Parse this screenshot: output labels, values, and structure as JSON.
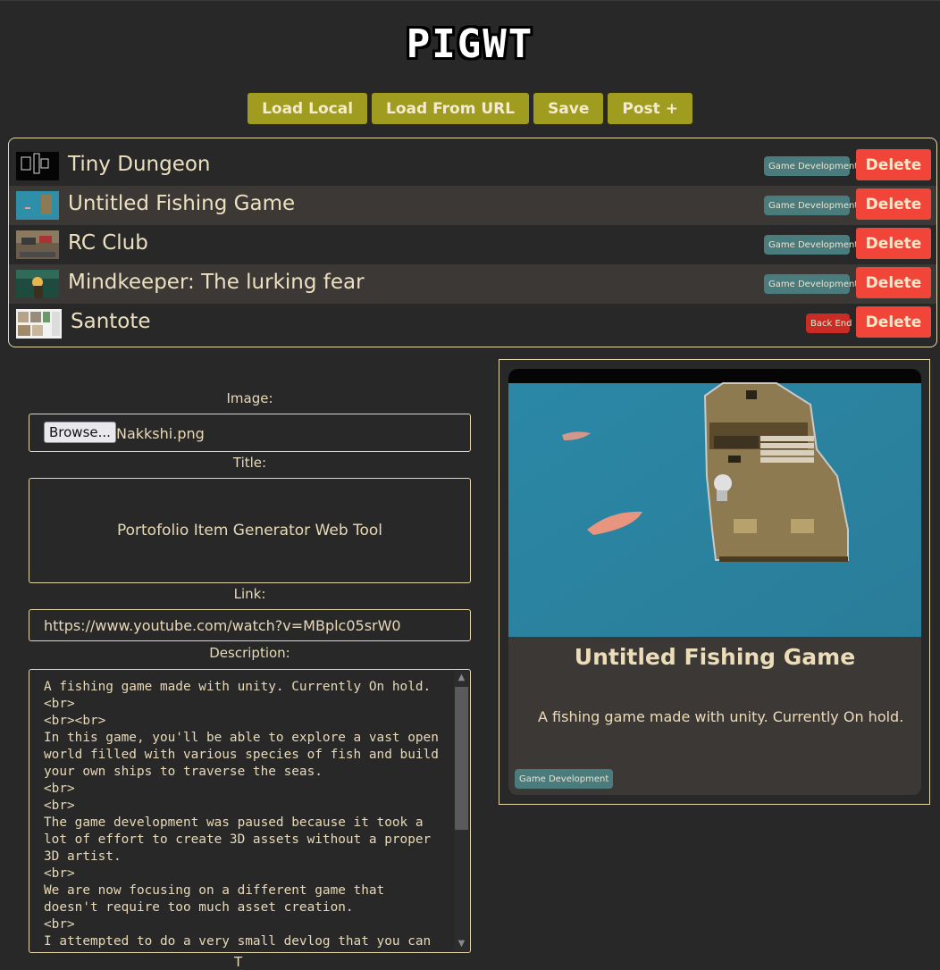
{
  "app": {
    "logo": "PIGWT"
  },
  "toolbar": {
    "load_local": "Load Local",
    "load_url": "Load From URL",
    "save": "Save",
    "post": "Post +"
  },
  "items": [
    {
      "title": "Tiny Dungeon",
      "tag": "Game Development",
      "delete": "Delete"
    },
    {
      "title": "Untitled Fishing Game",
      "tag": "Game Development",
      "delete": "Delete"
    },
    {
      "title": "RC Club",
      "tag": "Game Development",
      "delete": "Delete"
    },
    {
      "title": "Mindkeeper: The lurking fear",
      "tag": "Game Development",
      "delete": "Delete"
    },
    {
      "title": "Santote",
      "tag": "Back End",
      "delete": "Delete"
    }
  ],
  "form": {
    "image_label": "Image:",
    "browse_label": "Browse...",
    "file_name": "Nakkshi.png",
    "title_label": "Title:",
    "title_value": "Portofolio Item Generator Web Tool",
    "link_label": "Link:",
    "link_value": "https://www.youtube.com/watch?v=MBplc05srW0",
    "description_label": "Description:",
    "description_value": "A fishing game made with unity. Currently On hold.\n<br>\n<br><br>\nIn this game, you'll be able to explore a vast open world filled with various species of fish and build your own ships to traverse the seas.\n<br>\n<br>\nThe game development was paused because it took a lot of effort to create 3D assets without a proper 3D artist.\n<br>\nWe are now focusing on a different game that doesn't require too much asset creation.\n<br>\nI attempted to do a very small devlog that you can",
    "next_label_partial": "T"
  },
  "preview": {
    "title": "Untitled Fishing Game",
    "description": "A fishing game made with unity. Currently On hold.",
    "tag": "Game Development"
  },
  "colors": {
    "background": "#282828",
    "text": "#e8d9b8",
    "toolbar_button": "#9f9c1f",
    "delete_button": "#f2453a",
    "tag_game_dev": "#4a7b7d",
    "tag_back_end": "#c92b25",
    "alt_row": "#3c3836"
  }
}
